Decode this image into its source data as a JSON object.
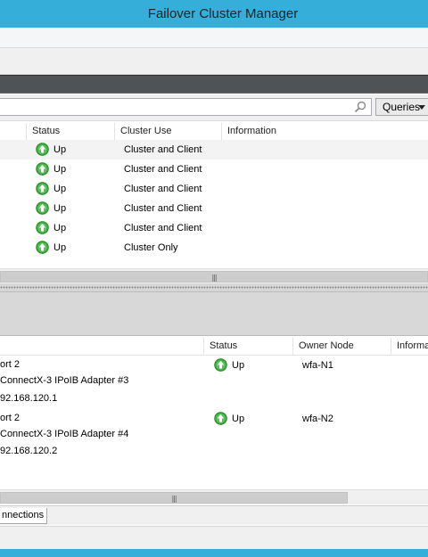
{
  "window": {
    "title": "Failover Cluster Manager"
  },
  "search": {
    "placeholder": "",
    "queries_label": "Queries"
  },
  "networks": {
    "columns": [
      "Status",
      "Cluster Use",
      "Information"
    ],
    "rows": [
      {
        "status": "Up",
        "cluster_use": "Cluster and Client",
        "information": ""
      },
      {
        "status": "Up",
        "cluster_use": "Cluster and Client",
        "information": ""
      },
      {
        "status": "Up",
        "cluster_use": "Cluster and Client",
        "information": ""
      },
      {
        "status": "Up",
        "cluster_use": "Cluster and Client",
        "information": ""
      },
      {
        "status": "Up",
        "cluster_use": "Cluster and Client",
        "information": ""
      },
      {
        "status": "Up",
        "cluster_use": "Cluster Only",
        "information": ""
      }
    ]
  },
  "connections": {
    "columns": [
      "Status",
      "Owner Node",
      "Informat"
    ],
    "rows": [
      {
        "name": "ort 2",
        "adapter": "ConnectX-3 IPoIB Adapter #3",
        "address": "92.168.120.1",
        "status": "Up",
        "owner_node": "wfa-N1"
      },
      {
        "name": "ort 2",
        "adapter": "ConnectX-3 IPoIB Adapter #4",
        "address": "92.168.120.2",
        "status": "Up",
        "owner_node": "wfa-N2"
      }
    ]
  },
  "bottom_tabs": [
    {
      "label": "nnections"
    }
  ],
  "colors": {
    "title_bar": "#35aeda",
    "status_up": "#3aa93a"
  }
}
